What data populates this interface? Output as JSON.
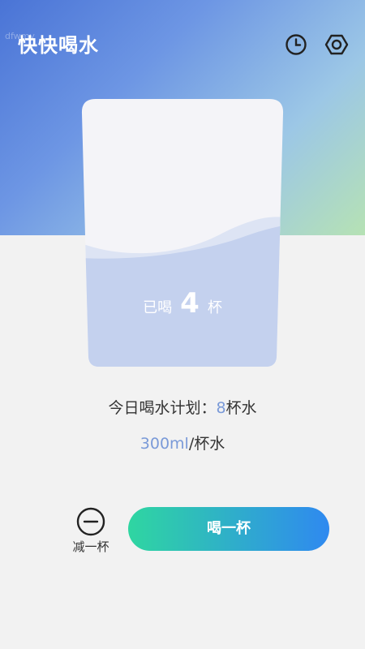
{
  "app": {
    "title": "快快喝水",
    "watermark": "dfwmy",
    "history_icon": "clock-icon",
    "settings_icon": "settings-hexagon-icon"
  },
  "cup": {
    "prefix": "已喝",
    "count": "4",
    "suffix": "杯",
    "fill_fraction": 0.5
  },
  "plan": {
    "label": "今日喝水计划：",
    "count": "8",
    "unit": "杯水"
  },
  "volume": {
    "amount": "300ml",
    "unit": "/杯水"
  },
  "actions": {
    "minus_label": "减一杯",
    "drink_label": "喝一杯"
  },
  "colors": {
    "accent": "#7a9ad8",
    "button_start": "#2fd6a1",
    "button_end": "#2f89f0",
    "water": "#c4d1ee"
  }
}
